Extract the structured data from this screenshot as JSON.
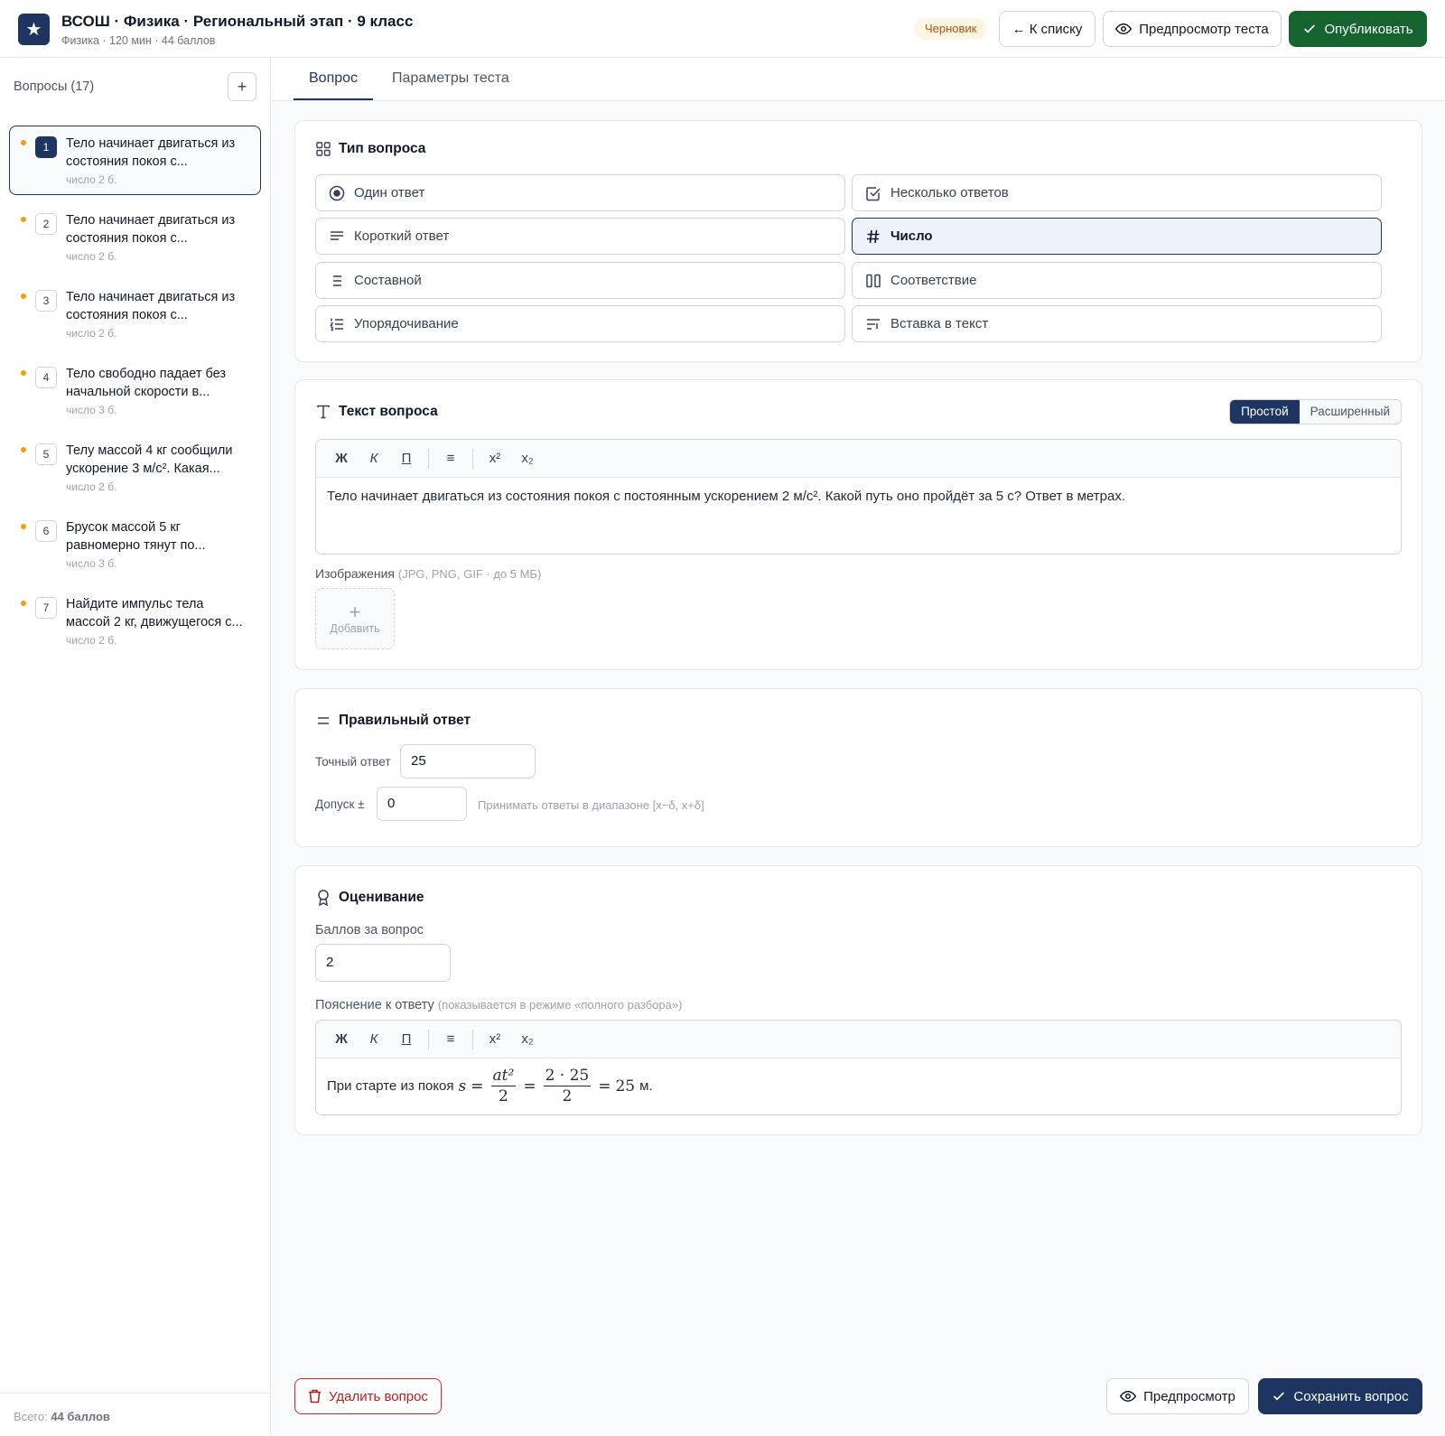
{
  "header": {
    "title": "ВСОШ · Физика · Региональный этап · 9 класс",
    "subtitle": "Физика · 120 мин · 44 баллов",
    "status_badge": "Черновик",
    "back_label": "← К списку",
    "preview_test_label": "Предпросмотр теста",
    "publish_label": "Опубликовать"
  },
  "sidebar": {
    "heading": "Вопросы (17)",
    "items": [
      {
        "num": "1",
        "text": "Тело начинает двигаться из состояния покоя с...",
        "meta": "число  2 б."
      },
      {
        "num": "2",
        "text": "Тело начинает двигаться из состояния покоя с...",
        "meta": "число  2 б."
      },
      {
        "num": "3",
        "text": "Тело начинает двигаться из состояния покоя с...",
        "meta": "число  2 б."
      },
      {
        "num": "4",
        "text": "Тело свободно падает без начальной скорости в...",
        "meta": "число  3 б."
      },
      {
        "num": "5",
        "text": "Телу массой 4 кг сообщили ускорение 3 м/с². Какая...",
        "meta": "число  2 б."
      },
      {
        "num": "6",
        "text": "Брусок массой 5 кг равномерно тянут по...",
        "meta": "число  3 б."
      },
      {
        "num": "7",
        "text": "Найдите импульс тела массой 2 кг, движущегося с...",
        "meta": "число  2 б."
      }
    ],
    "footer_prefix": "Всего: ",
    "footer_value": "44 баллов"
  },
  "tabs": [
    "Вопрос",
    "Параметры теста"
  ],
  "question_type": {
    "title": "Тип вопроса",
    "options": [
      "Один ответ",
      "Несколько ответов",
      "Короткий ответ",
      "Число",
      "Составной",
      "Соответствие",
      "Упорядочивание",
      "Вставка в текст"
    ],
    "selected": "Число"
  },
  "question_text": {
    "title": "Текст вопроса",
    "mode_simple": "Простой",
    "mode_advanced": "Расширенный",
    "toolbar": [
      "Ж",
      "К",
      "П",
      "≡",
      "x²",
      "x₂"
    ],
    "body": "Тело начинает двигаться из состояния покоя с постоянным ускорением 2 м/с². Какой путь оно пройдёт за 5 с? Ответ в метрах.",
    "images_label": "Изображения",
    "images_hint": "(JPG, PNG, GIF · до 5 МБ)",
    "add_label": "Добавить"
  },
  "correct_answer": {
    "title": "Правильный ответ",
    "exact_label": "Точный ответ",
    "exact_value": "25",
    "tolerance_label": "Допуск ±",
    "tolerance_value": "0",
    "tolerance_hint": "Принимать ответы в диапазоне [x−δ, x+δ]"
  },
  "grading": {
    "title": "Оценивание",
    "points_label": "Баллов за вопрос",
    "points_value": "2",
    "explanation_label": "Пояснение к ответу",
    "explanation_hint": "(показывается в режиме «полного разбора»)",
    "explanation_prefix": "При старте из покоя",
    "formula": {
      "lhs": "s",
      "frac1_num": "at²",
      "frac1_den": "2",
      "frac2_num": "2 · 25",
      "frac2_den": "2",
      "result": "25",
      "unit": "м."
    }
  },
  "footer": {
    "delete_label": "Удалить вопрос",
    "preview_label": "Предпросмотр",
    "save_label": "Сохранить вопрос"
  },
  "colors": {
    "accent": "#1e3461",
    "publish": "#15632f",
    "draft_badge": "#b45309",
    "danger": "#b91c1c",
    "unsaved_dot": "#f59e0b"
  }
}
